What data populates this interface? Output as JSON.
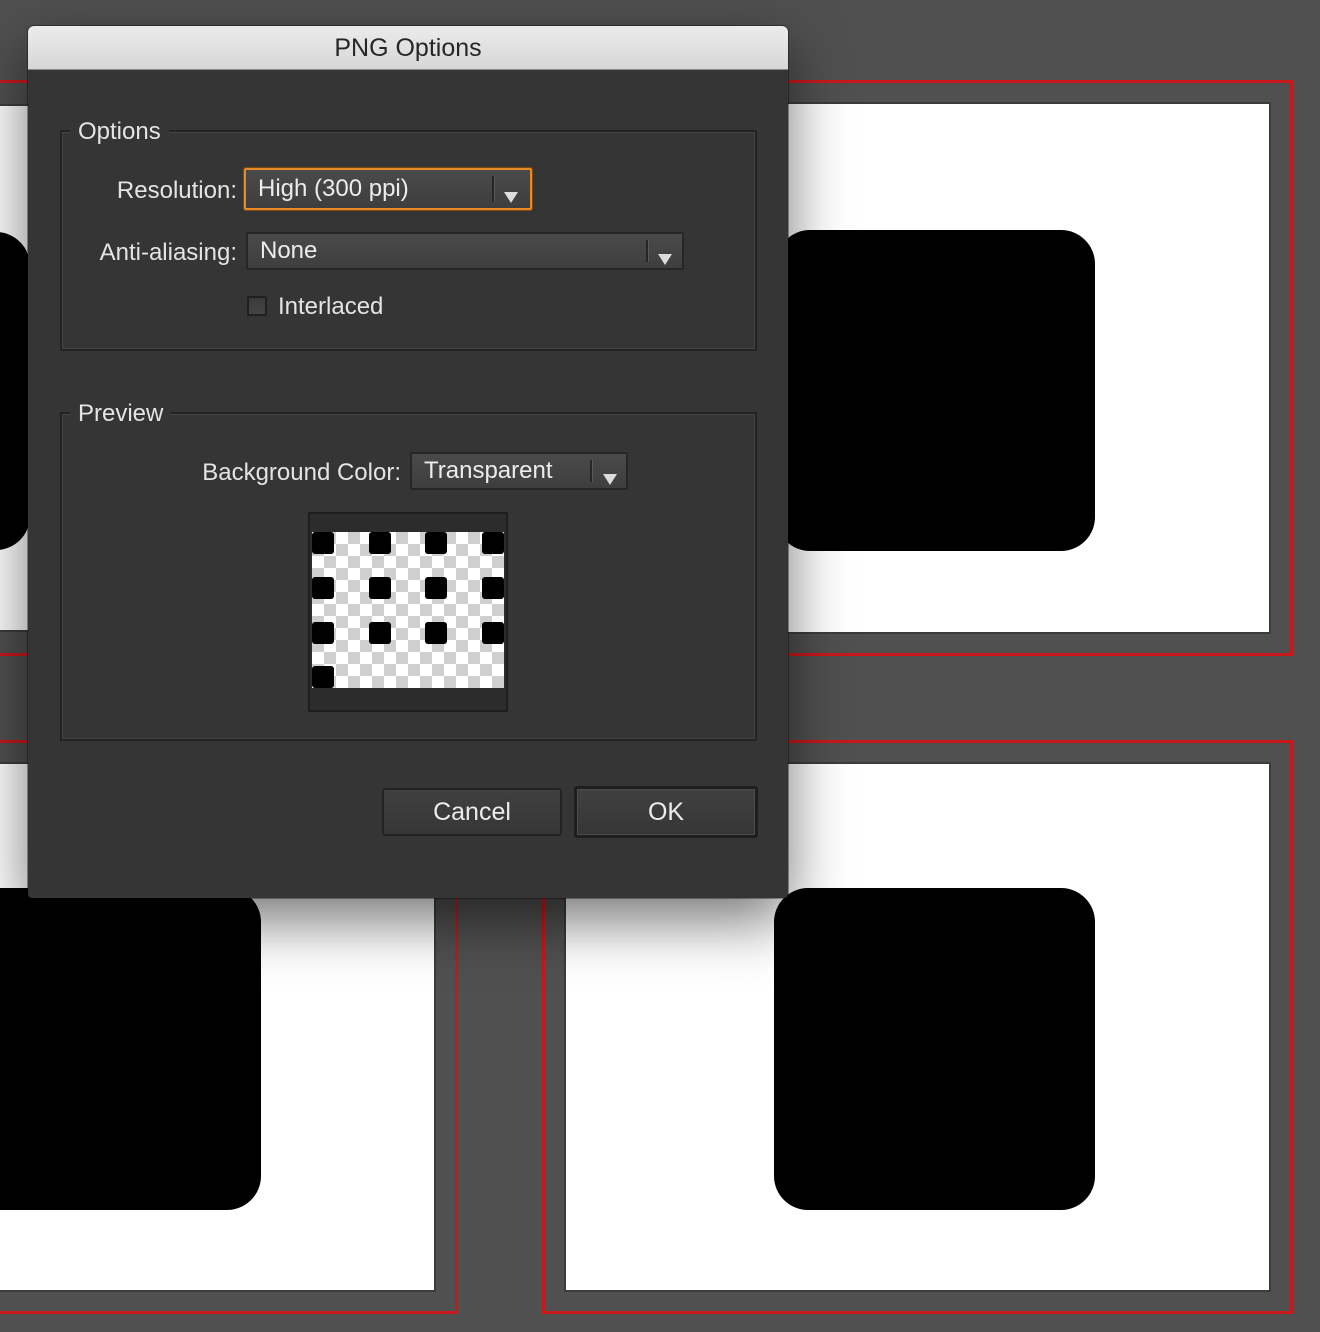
{
  "dialog": {
    "title": "PNG Options",
    "options_group": {
      "legend": "Options",
      "resolution": {
        "label": "Resolution:",
        "value": "High (300 ppi)"
      },
      "anti_aliasing": {
        "label": "Anti-aliasing:",
        "value": "None"
      },
      "interlaced": {
        "label": "Interlaced",
        "checked": false
      }
    },
    "preview_group": {
      "legend": "Preview",
      "background_color": {
        "label": "Background Color:",
        "value": "Transparent"
      }
    },
    "buttons": {
      "cancel": "Cancel",
      "ok": "OK"
    }
  },
  "colors": {
    "canvas_background": "#505050",
    "artboard_outline": "#c8181c",
    "dialog_background": "#353535",
    "focus_ring": "#e98a24"
  },
  "icons": {
    "dropdown_arrow": "chevron-down-icon",
    "preview": "transparency-checkerboard-icon"
  }
}
